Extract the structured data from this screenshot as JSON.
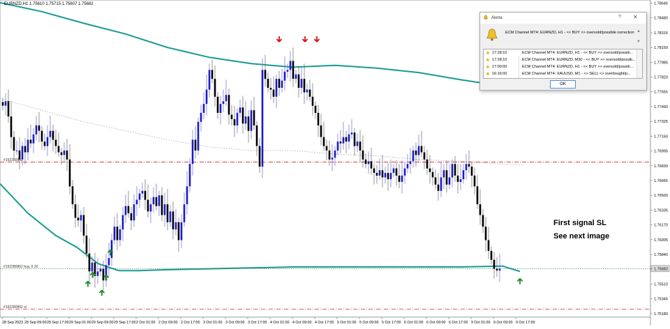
{
  "window": {
    "symbol_header": "EURNZD,H1  1.75610 1.75715 1.75607 1.75682"
  },
  "chart_data": {
    "type": "candlestick",
    "symbol": "EURNZD",
    "timeframe": "H1",
    "ohlc_header": [
      1.7561,
      1.75715,
      1.75607,
      1.75682
    ],
    "price_axis": {
      "min": 1.7514,
      "max": 1.7868,
      "tick_labels": [
        "1.78645",
        "1.78480",
        "1.78315",
        "1.78150",
        "1.77985",
        "1.77820",
        "1.77655",
        "1.77490",
        "1.77325",
        "1.77160",
        "1.76995",
        "1.76830",
        "1.76665",
        "1.76500",
        "1.76335",
        "1.76170",
        "1.76005",
        "1.75840",
        "1.75682",
        "1.75510",
        "1.75345",
        "1.75180"
      ],
      "current_price": "1.75682"
    },
    "time_axis": {
      "tick_labels": [
        "28 Sep 2023",
        "28 Sep 09:00",
        "28 Sep 17:00",
        "29 Sep 01:00",
        "29 Sep 09:00",
        "29 Sep 17:00",
        "2 Oct 01:00",
        "2 Oct 09:00",
        "2 Oct 17:00",
        "3 Oct 01:00",
        "3 Oct 09:00",
        "3 Oct 17:00",
        "4 Oct 01:00",
        "4 Oct 09:00",
        "4 Oct 17:00",
        "5 Oct 01:00",
        "5 Oct 09:00",
        "5 Oct 17:00",
        "6 Oct 01:00",
        "6 Oct 09:00",
        "6 Oct 17:00",
        "9 Oct 01:00",
        "9 Oct 09:00",
        "9 Oct 17:00"
      ]
    },
    "closes": [
      1.775,
      1.7755,
      1.7738,
      1.7715,
      1.77,
      1.77,
      1.769,
      1.7705,
      1.7698,
      1.7712,
      1.7708,
      1.7718,
      1.7728,
      1.7722,
      1.771,
      1.7705,
      1.7715,
      1.7722,
      1.7712,
      1.7705,
      1.7698,
      1.7695,
      1.77,
      1.769,
      1.766,
      1.764,
      1.7625,
      1.7622,
      1.7628,
      1.7605,
      1.7585,
      1.7565,
      1.7575,
      1.756,
      1.7565,
      1.7568,
      1.7555,
      1.7572,
      1.758,
      1.76,
      1.7615,
      1.76,
      1.7612,
      1.7628,
      1.7638,
      1.763,
      1.7622,
      1.764,
      1.7645,
      1.7652,
      1.7655,
      1.7645,
      1.7632,
      1.764,
      1.7648,
      1.7638,
      1.765,
      1.7628,
      1.764,
      1.762,
      1.7632,
      1.7612,
      1.762,
      1.76,
      1.762,
      1.764,
      1.766,
      1.7685,
      1.7712,
      1.77,
      1.7732,
      1.7742,
      1.7752,
      1.7768,
      1.779,
      1.778,
      1.776,
      1.7742,
      1.7752,
      1.7755,
      1.7762,
      1.774,
      1.7735,
      1.7728,
      1.7742,
      1.7748,
      1.773,
      1.7738,
      1.7722,
      1.7745,
      1.7728,
      1.7705,
      1.7682,
      1.779,
      1.778,
      1.777,
      1.7768,
      1.776,
      1.778,
      1.777,
      1.7778,
      1.7788,
      1.779,
      1.78,
      1.778,
      1.7785,
      1.777,
      1.778,
      1.7765,
      1.7768,
      1.776,
      1.775,
      1.7742,
      1.7728,
      1.7715,
      1.7705,
      1.77,
      1.769,
      1.7692,
      1.77,
      1.771,
      1.7708,
      1.7715,
      1.771,
      1.7718,
      1.772,
      1.7705,
      1.771,
      1.77,
      1.769,
      1.7685,
      1.7688,
      1.768,
      1.7675,
      1.7672,
      1.7678,
      1.767,
      1.7675,
      1.7668,
      1.7675,
      1.768,
      1.7672,
      1.7665,
      1.7672,
      1.768,
      1.7685,
      1.7688,
      1.77,
      1.7695,
      1.7705,
      1.7698,
      1.769,
      1.768,
      1.7676,
      1.767,
      1.7662,
      1.7655,
      1.767,
      1.7678,
      1.7662,
      1.767,
      1.7685,
      1.7672,
      1.7665,
      1.7668,
      1.7678,
      1.7685,
      1.7682,
      1.7672,
      1.766,
      1.764,
      1.7628,
      1.7615,
      1.76,
      1.7588,
      1.7578,
      1.7568,
      1.7566,
      1.7568
    ],
    "ma_fast_teal": [
      [
        0,
        1.7663
      ],
      [
        40,
        1.763
      ],
      [
        80,
        1.7605
      ],
      [
        110,
        1.7592
      ],
      [
        140,
        1.7574
      ],
      [
        170,
        1.7566
      ],
      [
        200,
        1.7566
      ],
      [
        240,
        1.7567
      ],
      [
        300,
        1.7568
      ],
      [
        360,
        1.7569
      ],
      [
        420,
        1.757
      ],
      [
        480,
        1.757
      ],
      [
        540,
        1.757
      ],
      [
        600,
        1.757
      ],
      [
        660,
        1.757
      ],
      [
        720,
        1.7571
      ],
      [
        745,
        1.7565
      ]
    ],
    "ma_slow_teal": [
      [
        0,
        1.7865
      ],
      [
        60,
        1.7855
      ],
      [
        120,
        1.7842
      ],
      [
        180,
        1.783
      ],
      [
        240,
        1.7815
      ],
      [
        300,
        1.7804
      ],
      [
        360,
        1.7797
      ],
      [
        420,
        1.7793
      ],
      [
        480,
        1.7795
      ],
      [
        540,
        1.7792
      ],
      [
        600,
        1.7787
      ],
      [
        660,
        1.7779
      ],
      [
        720,
        1.7772
      ],
      [
        750,
        1.777
      ]
    ],
    "ma_dotted_gray": [
      [
        0,
        1.7758
      ],
      [
        60,
        1.7745
      ],
      [
        120,
        1.7732
      ],
      [
        180,
        1.7722
      ],
      [
        240,
        1.7712
      ],
      [
        300,
        1.7704
      ],
      [
        360,
        1.77
      ],
      [
        420,
        1.77
      ],
      [
        480,
        1.7696
      ],
      [
        540,
        1.7694
      ],
      [
        600,
        1.769
      ],
      [
        660,
        1.7688
      ],
      [
        720,
        1.7685
      ],
      [
        750,
        1.7684
      ]
    ],
    "horizontal_levels": [
      {
        "label": "#192280852",
        "price": 1.7687,
        "color": "#cc0000",
        "style": "dashdot"
      },
      {
        "label": "#192280852 buy, 0.20",
        "price": 1.75682,
        "color": "#2e7d32",
        "style": "dotted"
      },
      {
        "label": "#192280852 sl",
        "price": 1.7523,
        "color": "#cc0000",
        "style": "dashdot"
      }
    ],
    "buy_arrows_x": [
      126,
      133,
      146,
      152,
      158,
      745
    ],
    "sell_arrows_x": [
      400,
      437,
      454
    ]
  },
  "annotations": {
    "line1": "First signal SL",
    "line2": "See next image"
  },
  "alert": {
    "title": "Alerta",
    "question_mark": "?",
    "close_mark": "✕",
    "message": "ECM Channel MT4:  EURNZD, H1  -  << BUY >> oversold/possible correction",
    "rows": [
      {
        "time": "17:28:10",
        "msg": "ECM Channel MT4:  EURNZD, H1  -  << BUY >> oversold/possib..."
      },
      {
        "time": "17:28:10",
        "msg": "ECM Channel MT4:  EURNZD, M30  -  << BUY >> oversold/possib..."
      },
      {
        "time": "17:00:00",
        "msg": "ECM Channel MT4:  EURNZD, H1  -  << BUY >> oversold/possib..."
      },
      {
        "time": "16:16:00",
        "msg": "ECM Channel MT4:  XAUUSD, M1  -  <> SELL <> overbought/p..."
      }
    ],
    "ok_label": "OK"
  },
  "colors": {
    "bull": "#1a1acc",
    "bear": "#000000",
    "wick_bull": "#6a6ae0",
    "ma": "#159a93",
    "buy_arrow": "#1e8a1e",
    "sell_arrow": "#e01010"
  }
}
